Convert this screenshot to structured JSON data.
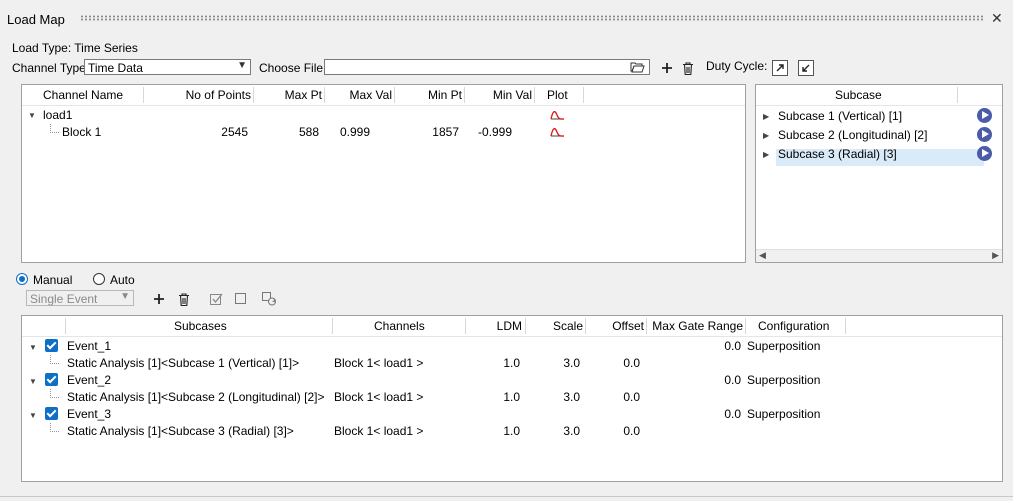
{
  "window": {
    "title": "Load Map"
  },
  "load_type_label": "Load Type: Time Series",
  "channel_type": {
    "label": "Channel Type:",
    "value": "Time Data"
  },
  "choose_file": {
    "label": "Choose File:",
    "value": ""
  },
  "duty_cycle_label": "Duty Cycle:",
  "channel_table": {
    "headers": [
      "Channel Name",
      "No of Points",
      "Max Pt",
      "Max Val",
      "Min Pt",
      "Min Val",
      "Plot"
    ],
    "group": "load1",
    "rows": [
      {
        "name": "Block 1",
        "points": "2545",
        "max_pt": "588",
        "max_val": "0.999",
        "min_pt": "1857",
        "min_val": "-0.999"
      }
    ]
  },
  "subcase_panel": {
    "header": "Subcase",
    "items": [
      {
        "label": "Subcase 1 (Vertical) [1]"
      },
      {
        "label": "Subcase 2 (Longitudinal) [2]"
      },
      {
        "label": "Subcase 3 (Radial) [3]"
      }
    ],
    "selected_index": 2
  },
  "mode": {
    "manual_label": "Manual",
    "auto_label": "Auto",
    "selected": "manual"
  },
  "event_type": {
    "value": "Single Event"
  },
  "events_table": {
    "headers": [
      "Subcases",
      "Channels",
      "LDM",
      "Scale",
      "Offset",
      "Max Gate Range",
      "Configuration"
    ],
    "events": [
      {
        "name": "Event_1",
        "max_gate": "0.0",
        "configuration": "Superposition",
        "subcase": "Static Analysis [1]<Subcase 1 (Vertical) [1]>",
        "channel": "Block 1< load1 >",
        "ldm": "1.0",
        "scale": "3.0",
        "offset": "0.0"
      },
      {
        "name": "Event_2",
        "max_gate": "0.0",
        "configuration": "Superposition",
        "subcase": "Static Analysis [1]<Subcase 2 (Longitudinal) [2]>",
        "channel": "Block 1< load1 >",
        "ldm": "1.0",
        "scale": "3.0",
        "offset": "0.0"
      },
      {
        "name": "Event_3",
        "max_gate": "0.0",
        "configuration": "Superposition",
        "subcase": "Static Analysis [1]<Subcase 3 (Radial) [3]>",
        "channel": "Block 1< load1 >",
        "ldm": "1.0",
        "scale": "3.0",
        "offset": "0.0"
      }
    ]
  },
  "colors": {
    "accent": "#0f6fc6",
    "selection": "#d9ebf9",
    "play": "#4a5ba8",
    "plot_icon": "#d62020"
  }
}
